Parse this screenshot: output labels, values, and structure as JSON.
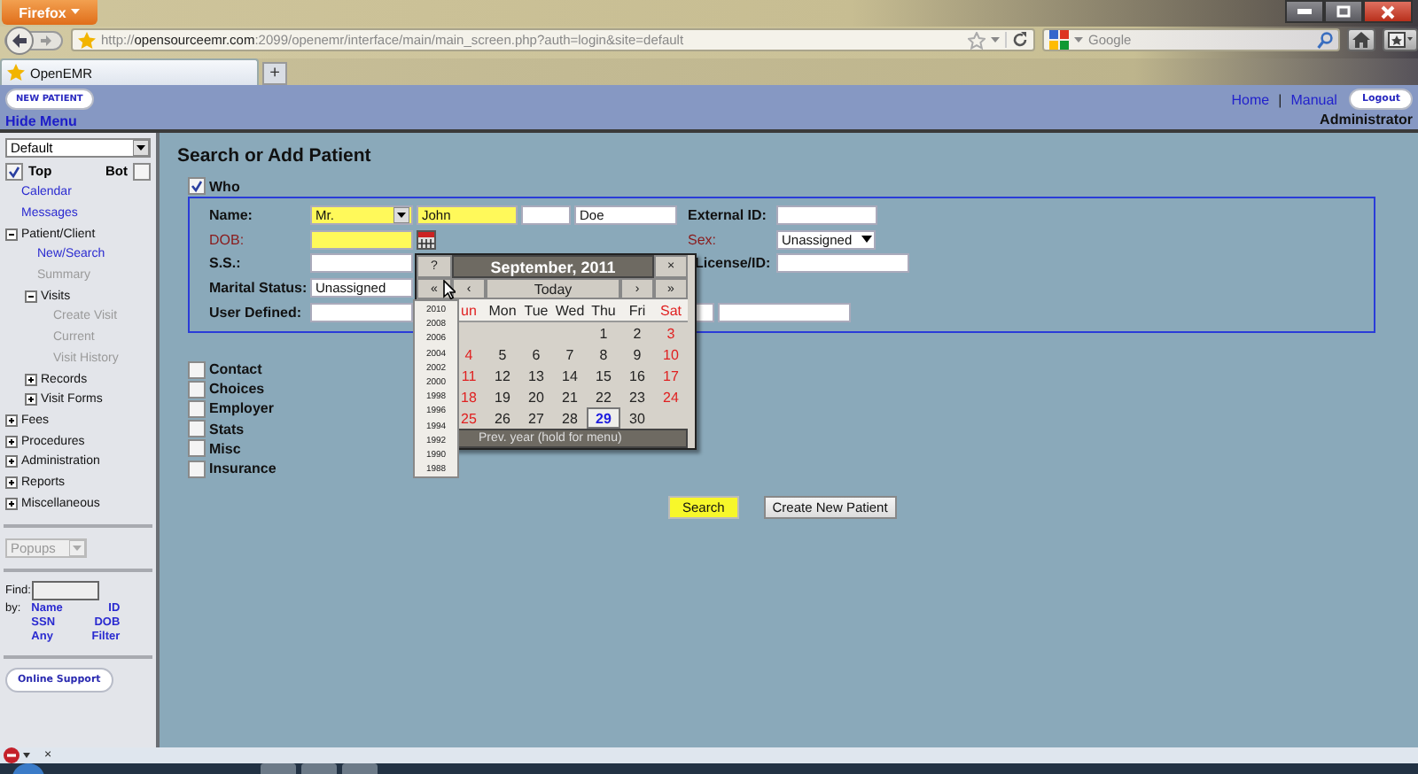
{
  "browser": {
    "menu_button": "Firefox",
    "url": "http://**opensourceemr.com**:2099/openemr/interface/main/main_screen.php?auth=login&site=default",
    "search_placeholder": "Google",
    "tabs": [
      {
        "label": "OpenEMR",
        "selected": true
      }
    ],
    "new_tab": "+"
  },
  "header": {
    "new_patient": "NEW PATIENT",
    "hide_menu": "Hide Menu",
    "links": [
      "Home",
      "Manual"
    ],
    "separator": "|",
    "logout": "Logout",
    "user": "Administrator"
  },
  "sidebar": {
    "view_select": "Default",
    "top": {
      "label": "Top",
      "checked": true
    },
    "bot": {
      "label": "Bot",
      "checked": false
    },
    "tree": [
      {
        "label": "Calendar",
        "kind": "leaf",
        "disabled": false
      },
      {
        "label": "Messages",
        "kind": "leaf",
        "disabled": false
      },
      {
        "label": "Patient/Client",
        "kind": "folder",
        "expanded": true,
        "disabled": false,
        "children": [
          {
            "label": "New/Search",
            "kind": "leaf",
            "disabled": false
          },
          {
            "label": "Summary",
            "kind": "leaf",
            "disabled": true
          },
          {
            "label": "Visits",
            "kind": "folder",
            "expanded": true,
            "disabled": false,
            "children": [
              {
                "label": "Create Visit",
                "kind": "leaf",
                "disabled": true
              },
              {
                "label": "Current",
                "kind": "leaf",
                "disabled": true
              },
              {
                "label": "Visit History",
                "kind": "leaf",
                "disabled": true
              }
            ]
          },
          {
            "label": "Records",
            "kind": "folder",
            "expanded": false,
            "disabled": false
          },
          {
            "label": "Visit Forms",
            "kind": "folder",
            "expanded": false,
            "disabled": false
          }
        ]
      },
      {
        "label": "Fees",
        "kind": "folder",
        "expanded": false,
        "disabled": false
      },
      {
        "label": "Procedures",
        "kind": "folder",
        "expanded": false,
        "disabled": false
      },
      {
        "label": "Administration",
        "kind": "folder",
        "expanded": false,
        "disabled": false
      },
      {
        "label": "Reports",
        "kind": "folder",
        "expanded": false,
        "disabled": false
      },
      {
        "label": "Miscellaneous",
        "kind": "folder",
        "expanded": false,
        "disabled": false
      }
    ],
    "popups_select": {
      "value": "Popups",
      "disabled": true
    },
    "find_label": "Find:",
    "by_label": "by:",
    "find_links": [
      "Name",
      "ID",
      "SSN",
      "DOB",
      "Any",
      "Filter"
    ],
    "online_support": "Online Support"
  },
  "main": {
    "title": "Search or Add Patient",
    "who": {
      "label": "Who",
      "checked": true
    },
    "form": {
      "name_label": {
        "text": "Name:",
        "required": false
      },
      "title": {
        "value": "Mr.",
        "highlighted": true
      },
      "first": {
        "value": "John",
        "highlighted": true
      },
      "middle": {
        "highlighted": false
      },
      "last": {
        "value": "Doe",
        "highlighted": false
      },
      "external_id_label": {
        "text": "External ID:",
        "required": false
      },
      "dob_label": {
        "text": "DOB:",
        "required": true
      },
      "dob": {
        "highlighted": true
      },
      "sex_label": {
        "text": "Sex:",
        "required": true
      },
      "sex": "Unassigned",
      "ss_label": {
        "text": "S.S.:",
        "required": false
      },
      "license_label": {
        "text": "License/ID:",
        "required": false
      },
      "marital_label": {
        "text": "Marital Status:",
        "required": false
      },
      "marital": "Unassigned",
      "user_defined_label": {
        "text": "User Defined:",
        "required": false
      }
    },
    "sections": [
      {
        "label": "Contact",
        "checked": false
      },
      {
        "label": "Choices",
        "checked": false
      },
      {
        "label": "Employer",
        "checked": false
      },
      {
        "label": "Stats",
        "checked": false
      },
      {
        "label": "Misc",
        "checked": false
      },
      {
        "label": "Insurance",
        "checked": false
      }
    ],
    "buttons": [
      {
        "label": "Search",
        "kind": "primary"
      },
      {
        "label": "Create New Patient",
        "kind": "normal"
      }
    ]
  },
  "calendar": {
    "help": "?",
    "title": "September, 2011",
    "close": "×",
    "nav": [
      "«",
      "‹",
      "Today",
      "›",
      "»"
    ],
    "weekdays": [
      "un",
      "Mon",
      "Tue",
      "Wed",
      "Thu",
      "Fri",
      "Sat"
    ],
    "weeks": [
      [
        {
          "kind": "blank"
        },
        {
          "kind": "blank"
        },
        {
          "kind": "blank"
        },
        {
          "kind": "blank"
        },
        {
          "kind": "day",
          "d": "1"
        },
        {
          "kind": "day",
          "d": "2"
        },
        {
          "kind": "day",
          "d": "3"
        }
      ],
      [
        {
          "kind": "day",
          "d": "4"
        },
        {
          "kind": "day",
          "d": "5"
        },
        {
          "kind": "day",
          "d": "6"
        },
        {
          "kind": "day",
          "d": "7"
        },
        {
          "kind": "day",
          "d": "8"
        },
        {
          "kind": "day",
          "d": "9"
        },
        {
          "kind": "day",
          "d": "10"
        }
      ],
      [
        {
          "kind": "day",
          "d": "11"
        },
        {
          "kind": "day",
          "d": "12"
        },
        {
          "kind": "day",
          "d": "13"
        },
        {
          "kind": "day",
          "d": "14"
        },
        {
          "kind": "day",
          "d": "15"
        },
        {
          "kind": "day",
          "d": "16"
        },
        {
          "kind": "day",
          "d": "17"
        }
      ],
      [
        {
          "kind": "day",
          "d": "18"
        },
        {
          "kind": "day",
          "d": "19"
        },
        {
          "kind": "day",
          "d": "20"
        },
        {
          "kind": "day",
          "d": "21"
        },
        {
          "kind": "day",
          "d": "22"
        },
        {
          "kind": "day",
          "d": "23"
        },
        {
          "kind": "day",
          "d": "24"
        }
      ],
      [
        {
          "kind": "day",
          "d": "25"
        },
        {
          "kind": "day",
          "d": "26"
        },
        {
          "kind": "day",
          "d": "27"
        },
        {
          "kind": "day",
          "d": "28"
        },
        {
          "kind": "today",
          "d": "29"
        },
        {
          "kind": "day",
          "d": "30"
        },
        {
          "kind": "blank"
        }
      ]
    ],
    "status": "Prev. year (hold for menu)",
    "year_menu": [
      "2010",
      "2008",
      "2006",
      "2004",
      "2002",
      "2000",
      "1998",
      "1996",
      "1994",
      "1992",
      "1990",
      "1988"
    ]
  },
  "status_bar": {
    "close": "×"
  }
}
